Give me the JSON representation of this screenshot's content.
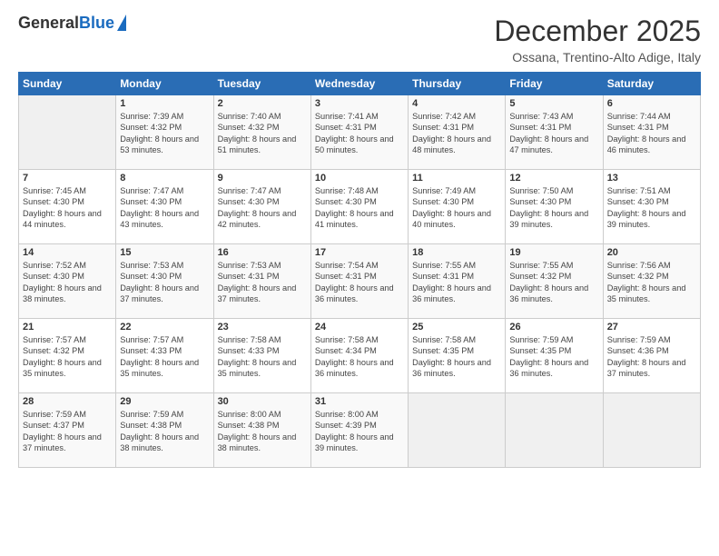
{
  "logo": {
    "general": "General",
    "blue": "Blue"
  },
  "title": "December 2025",
  "location": "Ossana, Trentino-Alto Adige, Italy",
  "weekdays": [
    "Sunday",
    "Monday",
    "Tuesday",
    "Wednesday",
    "Thursday",
    "Friday",
    "Saturday"
  ],
  "weeks": [
    [
      {
        "day": "",
        "sunrise": "",
        "sunset": "",
        "daylight": ""
      },
      {
        "day": "1",
        "sunrise": "Sunrise: 7:39 AM",
        "sunset": "Sunset: 4:32 PM",
        "daylight": "Daylight: 8 hours and 53 minutes."
      },
      {
        "day": "2",
        "sunrise": "Sunrise: 7:40 AM",
        "sunset": "Sunset: 4:32 PM",
        "daylight": "Daylight: 8 hours and 51 minutes."
      },
      {
        "day": "3",
        "sunrise": "Sunrise: 7:41 AM",
        "sunset": "Sunset: 4:31 PM",
        "daylight": "Daylight: 8 hours and 50 minutes."
      },
      {
        "day": "4",
        "sunrise": "Sunrise: 7:42 AM",
        "sunset": "Sunset: 4:31 PM",
        "daylight": "Daylight: 8 hours and 48 minutes."
      },
      {
        "day": "5",
        "sunrise": "Sunrise: 7:43 AM",
        "sunset": "Sunset: 4:31 PM",
        "daylight": "Daylight: 8 hours and 47 minutes."
      },
      {
        "day": "6",
        "sunrise": "Sunrise: 7:44 AM",
        "sunset": "Sunset: 4:31 PM",
        "daylight": "Daylight: 8 hours and 46 minutes."
      }
    ],
    [
      {
        "day": "7",
        "sunrise": "Sunrise: 7:45 AM",
        "sunset": "Sunset: 4:30 PM",
        "daylight": "Daylight: 8 hours and 44 minutes."
      },
      {
        "day": "8",
        "sunrise": "Sunrise: 7:47 AM",
        "sunset": "Sunset: 4:30 PM",
        "daylight": "Daylight: 8 hours and 43 minutes."
      },
      {
        "day": "9",
        "sunrise": "Sunrise: 7:47 AM",
        "sunset": "Sunset: 4:30 PM",
        "daylight": "Daylight: 8 hours and 42 minutes."
      },
      {
        "day": "10",
        "sunrise": "Sunrise: 7:48 AM",
        "sunset": "Sunset: 4:30 PM",
        "daylight": "Daylight: 8 hours and 41 minutes."
      },
      {
        "day": "11",
        "sunrise": "Sunrise: 7:49 AM",
        "sunset": "Sunset: 4:30 PM",
        "daylight": "Daylight: 8 hours and 40 minutes."
      },
      {
        "day": "12",
        "sunrise": "Sunrise: 7:50 AM",
        "sunset": "Sunset: 4:30 PM",
        "daylight": "Daylight: 8 hours and 39 minutes."
      },
      {
        "day": "13",
        "sunrise": "Sunrise: 7:51 AM",
        "sunset": "Sunset: 4:30 PM",
        "daylight": "Daylight: 8 hours and 39 minutes."
      }
    ],
    [
      {
        "day": "14",
        "sunrise": "Sunrise: 7:52 AM",
        "sunset": "Sunset: 4:30 PM",
        "daylight": "Daylight: 8 hours and 38 minutes."
      },
      {
        "day": "15",
        "sunrise": "Sunrise: 7:53 AM",
        "sunset": "Sunset: 4:30 PM",
        "daylight": "Daylight: 8 hours and 37 minutes."
      },
      {
        "day": "16",
        "sunrise": "Sunrise: 7:53 AM",
        "sunset": "Sunset: 4:31 PM",
        "daylight": "Daylight: 8 hours and 37 minutes."
      },
      {
        "day": "17",
        "sunrise": "Sunrise: 7:54 AM",
        "sunset": "Sunset: 4:31 PM",
        "daylight": "Daylight: 8 hours and 36 minutes."
      },
      {
        "day": "18",
        "sunrise": "Sunrise: 7:55 AM",
        "sunset": "Sunset: 4:31 PM",
        "daylight": "Daylight: 8 hours and 36 minutes."
      },
      {
        "day": "19",
        "sunrise": "Sunrise: 7:55 AM",
        "sunset": "Sunset: 4:32 PM",
        "daylight": "Daylight: 8 hours and 36 minutes."
      },
      {
        "day": "20",
        "sunrise": "Sunrise: 7:56 AM",
        "sunset": "Sunset: 4:32 PM",
        "daylight": "Daylight: 8 hours and 35 minutes."
      }
    ],
    [
      {
        "day": "21",
        "sunrise": "Sunrise: 7:57 AM",
        "sunset": "Sunset: 4:32 PM",
        "daylight": "Daylight: 8 hours and 35 minutes."
      },
      {
        "day": "22",
        "sunrise": "Sunrise: 7:57 AM",
        "sunset": "Sunset: 4:33 PM",
        "daylight": "Daylight: 8 hours and 35 minutes."
      },
      {
        "day": "23",
        "sunrise": "Sunrise: 7:58 AM",
        "sunset": "Sunset: 4:33 PM",
        "daylight": "Daylight: 8 hours and 35 minutes."
      },
      {
        "day": "24",
        "sunrise": "Sunrise: 7:58 AM",
        "sunset": "Sunset: 4:34 PM",
        "daylight": "Daylight: 8 hours and 36 minutes."
      },
      {
        "day": "25",
        "sunrise": "Sunrise: 7:58 AM",
        "sunset": "Sunset: 4:35 PM",
        "daylight": "Daylight: 8 hours and 36 minutes."
      },
      {
        "day": "26",
        "sunrise": "Sunrise: 7:59 AM",
        "sunset": "Sunset: 4:35 PM",
        "daylight": "Daylight: 8 hours and 36 minutes."
      },
      {
        "day": "27",
        "sunrise": "Sunrise: 7:59 AM",
        "sunset": "Sunset: 4:36 PM",
        "daylight": "Daylight: 8 hours and 37 minutes."
      }
    ],
    [
      {
        "day": "28",
        "sunrise": "Sunrise: 7:59 AM",
        "sunset": "Sunset: 4:37 PM",
        "daylight": "Daylight: 8 hours and 37 minutes."
      },
      {
        "day": "29",
        "sunrise": "Sunrise: 7:59 AM",
        "sunset": "Sunset: 4:38 PM",
        "daylight": "Daylight: 8 hours and 38 minutes."
      },
      {
        "day": "30",
        "sunrise": "Sunrise: 8:00 AM",
        "sunset": "Sunset: 4:38 PM",
        "daylight": "Daylight: 8 hours and 38 minutes."
      },
      {
        "day": "31",
        "sunrise": "Sunrise: 8:00 AM",
        "sunset": "Sunset: 4:39 PM",
        "daylight": "Daylight: 8 hours and 39 minutes."
      },
      {
        "day": "",
        "sunrise": "",
        "sunset": "",
        "daylight": ""
      },
      {
        "day": "",
        "sunrise": "",
        "sunset": "",
        "daylight": ""
      },
      {
        "day": "",
        "sunrise": "",
        "sunset": "",
        "daylight": ""
      }
    ]
  ]
}
